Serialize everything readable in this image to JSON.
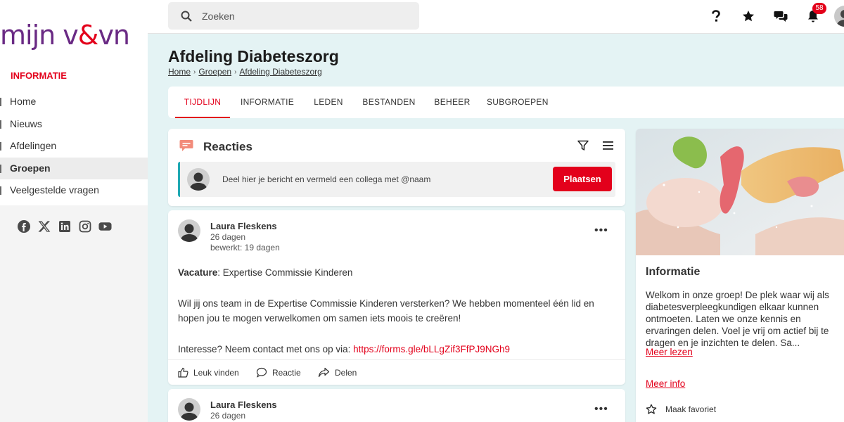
{
  "logo": {
    "part1": "mijn v",
    "amp": "&",
    "part2": "vn"
  },
  "sidebar": {
    "heading": "INFORMATIE",
    "items": [
      {
        "label": "Home"
      },
      {
        "label": "Nieuws"
      },
      {
        "label": "Afdelingen"
      },
      {
        "label": "Groepen",
        "active": true
      },
      {
        "label": "Veelgestelde vragen"
      }
    ],
    "socials": [
      "facebook-icon",
      "x-icon",
      "linkedin-icon",
      "instagram-icon",
      "youtube-icon"
    ]
  },
  "search": {
    "placeholder": "Zoeken"
  },
  "topbar": {
    "notification_count": "58"
  },
  "page": {
    "title": "Afdeling Diabeteszorg",
    "breadcrumb": [
      "Home",
      "Groepen",
      "Afdeling Diabeteszorg"
    ]
  },
  "tabs": [
    {
      "label": "TIJDLIJN",
      "active": true
    },
    {
      "label": "INFORMATIE"
    },
    {
      "label": "LEDEN"
    },
    {
      "label": "BESTANDEN"
    },
    {
      "label": "BEHEER"
    },
    {
      "label": "SUBGROEPEN"
    }
  ],
  "reacties": {
    "title": "Reacties",
    "composer_placeholder": "Deel hier je bericht en vermeld een collega met @naam",
    "post_button": "Plaatsen"
  },
  "posts": [
    {
      "author": "Laura Fleskens",
      "date": "26 dagen",
      "edited": "bewerkt: 19 dagen",
      "title_bold": "Vacature",
      "title_rest": ": Expertise Commissie Kinderen",
      "paragraph": "Wil jij ons team in de Expertise Commissie Kinderen versterken? We hebben momenteel één lid en hopen jou te mogen verwelkomen om samen iets moois te creëren!",
      "contact_text": "Interesse? Neem contact met ons op via: ",
      "link": "https://forms.gle/bLLgZif3FfPJ9NGh9",
      "actions": {
        "like": "Leuk vinden",
        "reply": "Reactie",
        "share": "Delen"
      }
    },
    {
      "author": "Laura Fleskens",
      "date": "26 dagen"
    }
  ],
  "info": {
    "title": "Informatie",
    "text": "Welkom in onze groep! De plek waar wij als diabetesverpleegkundigen elkaar kunnen ontmoeten. Laten we onze kennis en ervaringen delen. Voel je vrij om actief bij te dragen en je inzichten te delen. Sa...",
    "read_more": "Meer lezen",
    "more_info": "Meer info",
    "favorite": "Maak favoriet"
  },
  "colors": {
    "accent": "#e3001b",
    "brand_purple": "#6a2a84",
    "teal": "#1fa8b3",
    "page_bg": "#e4f3f4"
  }
}
